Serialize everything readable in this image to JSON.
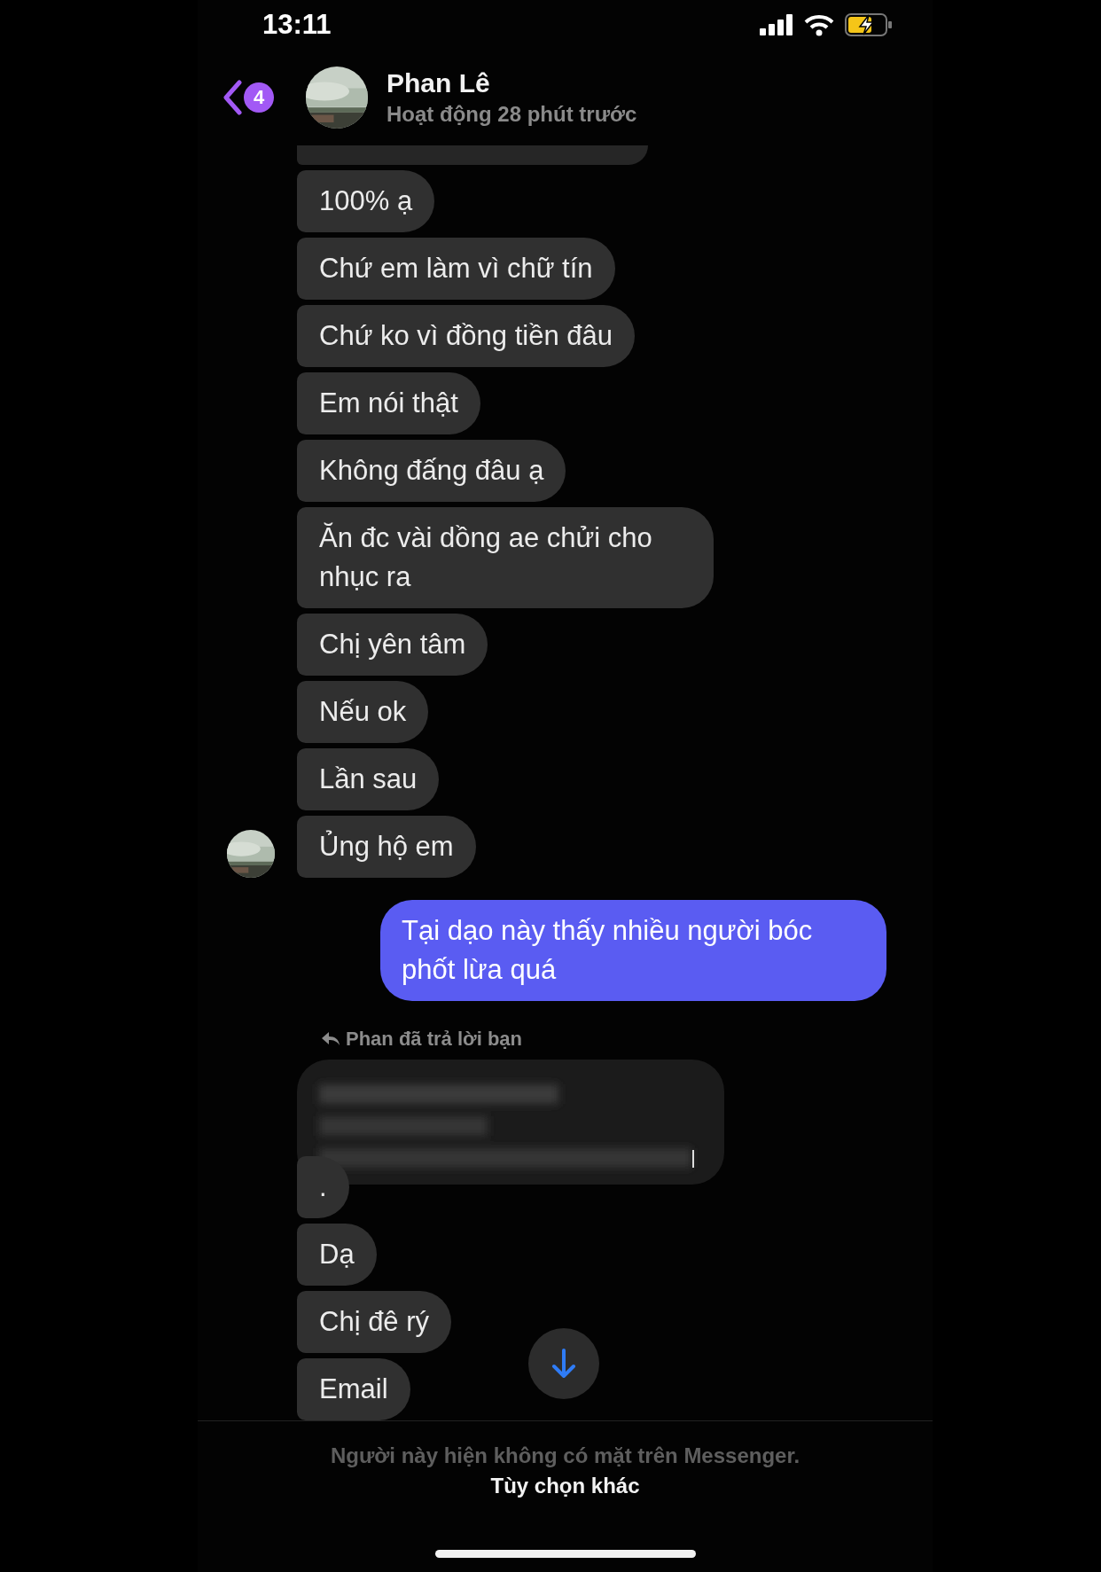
{
  "status_bar": {
    "time": "13:11",
    "battery_charging": true
  },
  "header": {
    "back_badge": "4",
    "contact_name": "Phan Lê",
    "status": "Hoạt động 28 phút trước"
  },
  "messages": [
    {
      "kind": "incoming_cut"
    },
    {
      "kind": "incoming",
      "text": "100% ạ",
      "avatar": false
    },
    {
      "kind": "incoming",
      "text": "Chứ em làm vì chữ tín",
      "avatar": false
    },
    {
      "kind": "incoming",
      "text": "Chứ ko vì đồng tiền đâu",
      "avatar": false
    },
    {
      "kind": "incoming",
      "text": "Em nói thật",
      "avatar": false
    },
    {
      "kind": "incoming",
      "text": "Không đấng đâu ạ",
      "avatar": false
    },
    {
      "kind": "incoming",
      "text": "Ăn đc vài dồng ae chửi cho nhục ra",
      "avatar": false
    },
    {
      "kind": "incoming",
      "text": "Chị yên tâm",
      "avatar": false
    },
    {
      "kind": "incoming",
      "text": "Nếu ok",
      "avatar": false
    },
    {
      "kind": "incoming",
      "text": "Lần sau",
      "avatar": false
    },
    {
      "kind": "incoming",
      "text": "Ủng hộ em",
      "avatar": true
    },
    {
      "kind": "outgoing",
      "text": "Tại dạo này thấy nhiều người bóc phốt lừa quá"
    },
    {
      "kind": "reply_label",
      "text": "Phan đã trả lời bạn"
    },
    {
      "kind": "redacted"
    },
    {
      "kind": "incoming",
      "text": ".",
      "avatar": false
    },
    {
      "kind": "incoming",
      "text": "Dạ",
      "avatar": false
    },
    {
      "kind": "incoming",
      "text": "Chị đê rý",
      "avatar": false
    },
    {
      "kind": "incoming",
      "text": "Email",
      "avatar": false
    }
  ],
  "footer": {
    "notice": "Người này hiện không có mặt trên Messenger.",
    "link": "Tùy chọn khác"
  }
}
